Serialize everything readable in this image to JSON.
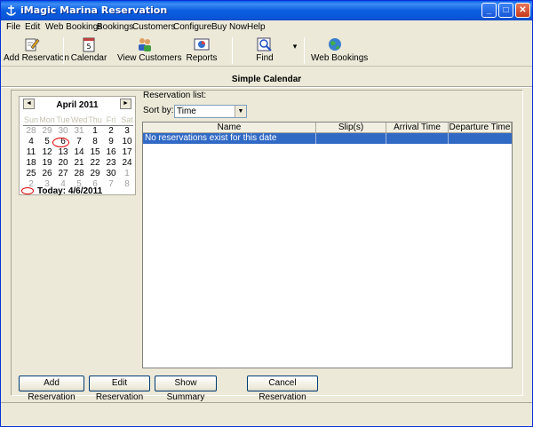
{
  "window": {
    "title": "iMagic Marina Reservation"
  },
  "title_controls": {
    "minimize": "_",
    "maximize": "□",
    "close": "✕"
  },
  "menu": [
    "File",
    "Edit",
    "Web Bookings",
    "Bookings",
    "Customers",
    "Configure",
    "Buy Now",
    "Help"
  ],
  "toolbar": {
    "add_reservation": "Add Reservation",
    "calendar": "Calendar",
    "view_customers": "View Customers",
    "reports": "Reports",
    "find": "Find",
    "web_bookings": "Web Bookings",
    "find_dropdown_arrow": "▾"
  },
  "page": {
    "title": "Simple Calendar"
  },
  "calendar": {
    "prev": "◄",
    "next": "►",
    "month": "April 2011",
    "weekdays": [
      "Sun",
      "Mon",
      "Tue",
      "Wed",
      "Thu",
      "Fri",
      "Sat"
    ],
    "weeks": [
      [
        "28",
        "29",
        "30",
        "31",
        "1",
        "2",
        "3"
      ],
      [
        "4",
        "5",
        "6",
        "7",
        "8",
        "9",
        "10"
      ],
      [
        "11",
        "12",
        "13",
        "14",
        "15",
        "16",
        "17"
      ],
      [
        "18",
        "19",
        "20",
        "21",
        "22",
        "23",
        "24"
      ],
      [
        "25",
        "26",
        "27",
        "28",
        "29",
        "30",
        "1"
      ],
      [
        "2",
        "3",
        "4",
        "5",
        "6",
        "7",
        "8"
      ]
    ],
    "today_label": "Today: 4/6/2011",
    "selected_day": "6"
  },
  "reservations": {
    "list_label": "Reservation list:",
    "sort_label": "Sort by:",
    "sort_value": "Time",
    "sort_arrow": "▼",
    "columns": [
      "Name",
      "Slip(s)",
      "Arrival Time",
      "Departure Time"
    ],
    "empty_message": "No reservations exist for this date"
  },
  "buttons": {
    "add": "Add Reservation",
    "edit": "Edit Reservation",
    "summary": "Show Summary",
    "cancel": "Cancel Reservation"
  },
  "colors": {
    "titlebar": "#0a5ee6",
    "selection": "#316ac5",
    "today_mark": "#e00000"
  }
}
